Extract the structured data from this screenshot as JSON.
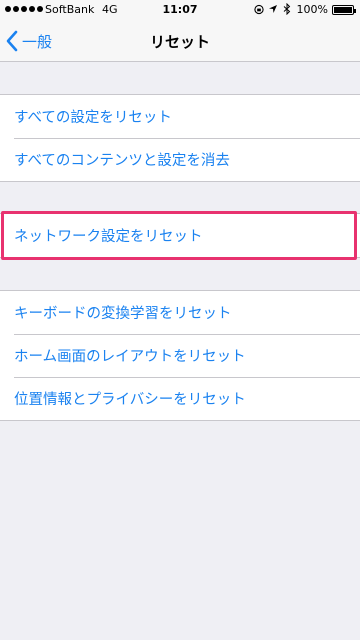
{
  "status_bar": {
    "carrier": "SoftBank",
    "network": "4G",
    "time": "11:07",
    "battery": "100%",
    "icons": [
      "orientation-lock-icon",
      "location-arrow-icon",
      "bluetooth-icon"
    ]
  },
  "nav": {
    "back_label": "一般",
    "title": "リセット"
  },
  "groups": [
    {
      "items": [
        "すべての設定をリセット",
        "すべてのコンテンツと設定を消去"
      ]
    },
    {
      "items": [
        "ネットワーク設定をリセット"
      ]
    },
    {
      "items": [
        "キーボードの変換学習をリセット",
        "ホーム画面のレイアウトをリセット",
        "位置情報とプライバシーをリセット"
      ]
    }
  ],
  "colors": {
    "accent": "#1a82f0",
    "highlight": "#e8326f",
    "background": "#efeff4"
  }
}
